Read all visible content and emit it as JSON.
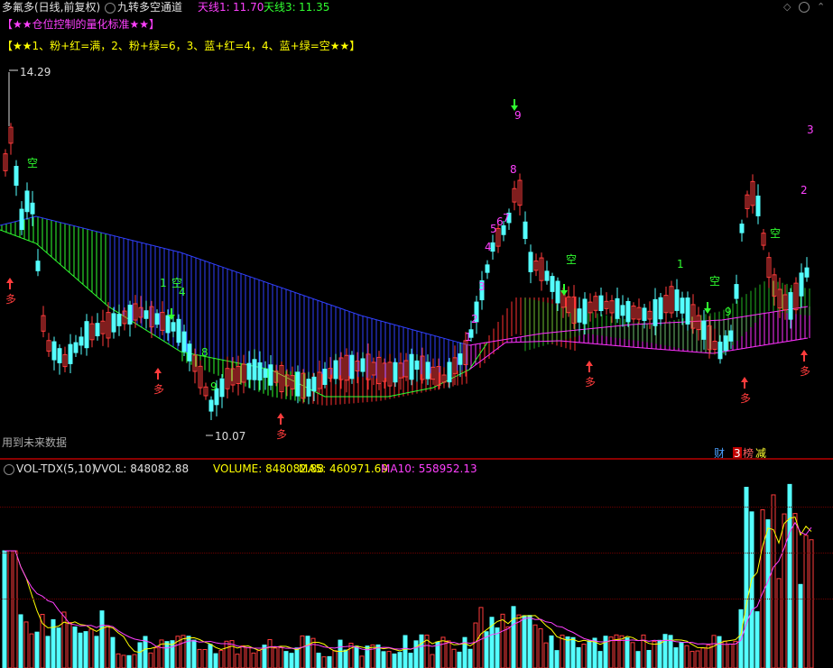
{
  "header": {
    "title": "多氟多(日线,前复权)",
    "indicator_name": "九转多空通道",
    "line1_label": "天线1:",
    "line1_value": "11.70",
    "line3_label": "天线3:",
    "line3_value": "11.35"
  },
  "legend": {
    "line1": "【★★仓位控制的量化标准★★】",
    "line2": "【★★1、粉+红=满，2、粉+绿=6，3、蓝+红=4，4、蓝+绿=空★★】"
  },
  "price_labels": {
    "high": "14.29",
    "low": "10.07"
  },
  "future_data_note": "用到未来数据",
  "badges": {
    "cai": "财",
    "bang": "榜",
    "jian": "减",
    "num": "3"
  },
  "volume_header": {
    "name": "VOL-TDX(5,10)",
    "vvol": "VVOL: 848082.88",
    "volume": "VOLUME: 848082.88",
    "ma5": "MA5: 460971.69",
    "ma10": "MA10: 558952.13"
  },
  "colors": {
    "up": "#ff3c3c",
    "down": "#54ffff",
    "blue_band": "#3040ff",
    "pink_band": "#ff30ff",
    "green_band": "#30ff30",
    "yellow": "#ffff00",
    "magenta": "#ff40ff"
  },
  "signals": {
    "long": "多",
    "short": "空"
  },
  "chart_data": {
    "type": "candlestick",
    "price_range": [
      10.07,
      14.29
    ],
    "count_labels": [
      "1",
      "2",
      "3",
      "4",
      "5",
      "6",
      "7",
      "8",
      "9"
    ]
  }
}
